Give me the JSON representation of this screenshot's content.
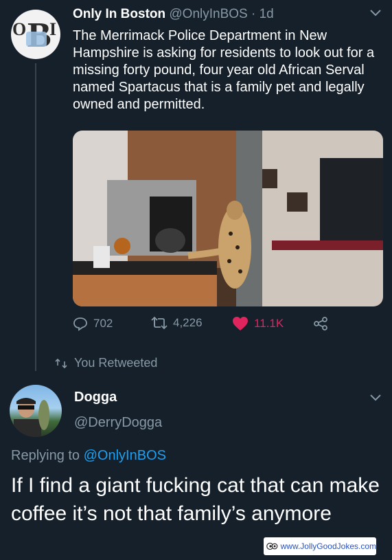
{
  "tweet": {
    "author_name": "Only In Boston",
    "author_handle": "@OnlyInBOS",
    "separator": "·",
    "time": "1d",
    "avatar_letters": {
      "left": "O",
      "center": "B",
      "right": "I"
    },
    "text": "The Merrimack Police Department in New Hampshire is asking for residents to look out for a missing forty pound, four year old African Serval named Spartacus that is a family pet and legally owned and permitted.",
    "actions": {
      "replies": "702",
      "retweets": "4,226",
      "likes": "11.1K"
    },
    "liked": true
  },
  "retweet_notice": "You Retweeted",
  "reply": {
    "author_name": "Dogga",
    "author_handle": "@DerryDogga",
    "replying_prefix": "Replying to",
    "replying_to": "@OnlyInBOS",
    "text": "If I find a giant fucking cat that can make coffee it’s not that family’s anymore"
  },
  "watermark": {
    "text": "www.JollyGoodJokes.com"
  },
  "colors": {
    "background": "#15202b",
    "secondary_text": "#8899a6",
    "like": "#e0245e",
    "link": "#1da1f2"
  },
  "icons": [
    "reply-icon",
    "retweet-icon",
    "heart-icon",
    "share-icon",
    "chevron-down-icon"
  ]
}
